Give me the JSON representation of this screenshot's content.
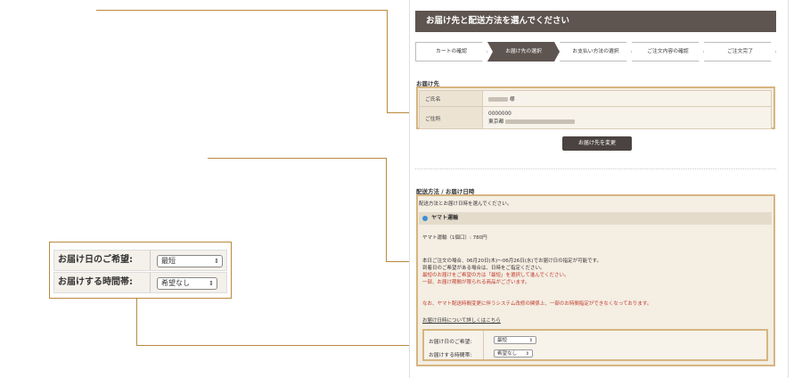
{
  "header": {
    "title": "お届け先と配送方法を選んでください"
  },
  "steps": [
    {
      "label": "カートの確認",
      "active": false
    },
    {
      "label": "お届け先の選択",
      "active": true
    },
    {
      "label": "お支払い方法の選択",
      "active": false
    },
    {
      "label": "ご注文内容の確認",
      "active": false
    },
    {
      "label": "ご注文完了",
      "active": false
    }
  ],
  "address": {
    "section_title": "お届け先",
    "name_label": "ご氏名",
    "name_suffix": "様",
    "address_label": "ご住所",
    "postal_code": "0000000",
    "address_prefix": "東京都",
    "change_button": "お届け先を変更"
  },
  "delivery": {
    "section_title": "配送方法 / お届け日時",
    "instruction": "配送方法とお届け日時を選んでください。",
    "carrier": "ヤマト運輸",
    "fee_line": "ヤマト運輸（1個口）: 780円",
    "notice1": "本日ご注文の場合、06月20日(木)〜06月26日(水)でお届け日の指定が可能です。",
    "notice2": "到着日のご希望がある場合は、日時をご指定ください。",
    "red1": "最短のお届けをご希望の方は「最短」を選択して進んでください。",
    "red2": "一部、お届け期間が限られる商品がございます。",
    "red3": "なお、ヤマト配送時間変更に伴うシステム改修の関係上、一部のお時間指定ができなくなっております。",
    "link": "お届け日時について詳しくはこちら",
    "date_label": "お届け日のご希望:",
    "date_value": "最短",
    "time_label": "お届けする時間帯:",
    "time_value": "希望なし"
  },
  "zoom": {
    "date_label": "お届け日のご希望:",
    "date_value": "最短",
    "time_label": "お届けする時間帯:",
    "time_value": "希望なし"
  },
  "colors": {
    "header_bg": "#5e5450",
    "highlight": "#d6b580",
    "callout_line": "#b98a3c",
    "radio": "#3d8fd6"
  }
}
